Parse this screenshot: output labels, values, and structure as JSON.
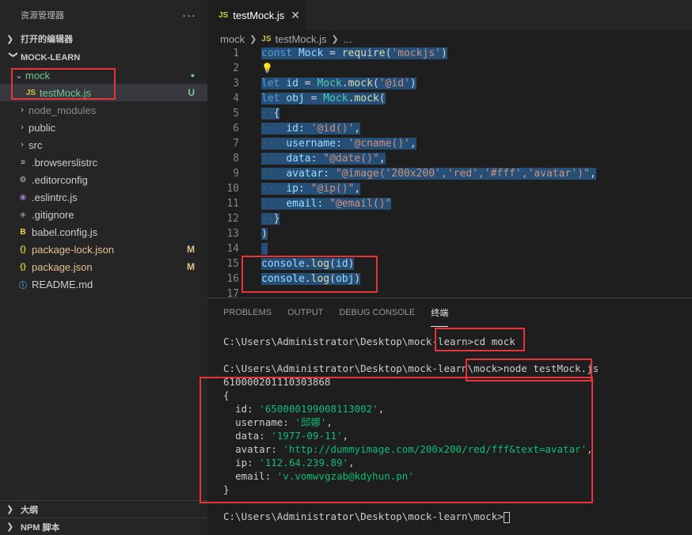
{
  "sidebar": {
    "title": "资源管理器",
    "more": "···",
    "open_editors": "打开的编辑器",
    "project": "MOCK-LEARN",
    "items": [
      {
        "name": "mock",
        "type": "folder-open",
        "badge": "●"
      },
      {
        "name": "testMock.js",
        "type": "js",
        "badge": "U"
      },
      {
        "name": "node_modules",
        "type": "folder"
      },
      {
        "name": "public",
        "type": "folder"
      },
      {
        "name": "src",
        "type": "folder"
      },
      {
        "name": ".browserslistrc",
        "type": "list"
      },
      {
        "name": ".editorconfig",
        "type": "gear"
      },
      {
        "name": ".eslintrc.js",
        "type": "eslint"
      },
      {
        "name": ".gitignore",
        "type": "git"
      },
      {
        "name": "babel.config.js",
        "type": "babel"
      },
      {
        "name": "package-lock.json",
        "type": "json",
        "badge": "M"
      },
      {
        "name": "package.json",
        "type": "json",
        "badge": "M"
      },
      {
        "name": "README.md",
        "type": "info"
      }
    ],
    "outline": "大纲",
    "npm": "NPM 脚本"
  },
  "editor": {
    "tab_label": "testMock.js",
    "tab_icon": "JS",
    "breadcrumb": [
      "mock",
      "testMock.js",
      "..."
    ]
  },
  "code_lines": [
    {
      "n": "1"
    },
    {
      "n": "2"
    },
    {
      "n": "3"
    },
    {
      "n": "4"
    },
    {
      "n": "5"
    },
    {
      "n": "6"
    },
    {
      "n": "7"
    },
    {
      "n": "8"
    },
    {
      "n": "9"
    },
    {
      "n": "10"
    },
    {
      "n": "11"
    },
    {
      "n": "12"
    },
    {
      "n": "13"
    },
    {
      "n": "14"
    },
    {
      "n": "15"
    },
    {
      "n": "16"
    },
    {
      "n": "17"
    }
  ],
  "code": {
    "l1": [
      "const",
      "Mock",
      "require",
      "'mockjs'"
    ],
    "l3": [
      "let",
      "id",
      "Mock",
      "mock",
      "'@id'"
    ],
    "l4": [
      "let",
      "obj",
      "Mock",
      "mock"
    ],
    "l6": [
      "id",
      "'@id()'"
    ],
    "l7": [
      "username",
      "'@cname()'"
    ],
    "l8": [
      "data",
      "\"@date()\""
    ],
    "l9": [
      "avatar",
      "\"@image('200x200','red','#fff','avatar')\""
    ],
    "l10": [
      "ip",
      "\"@ip()\""
    ],
    "l11": [
      "email",
      "\"@email()\""
    ],
    "l15": [
      "console",
      "log",
      "id"
    ],
    "l16": [
      "console",
      "log",
      "obj"
    ]
  },
  "panel": {
    "tabs": [
      "PROBLEMS",
      "OUTPUT",
      "DEBUG CONSOLE",
      "终端"
    ],
    "active_tab": "终端"
  },
  "terminal": {
    "prompt1": "C:\\Users\\Administrator\\Desktop\\mock-learn>",
    "cmd1": "cd mock",
    "prompt2": "C:\\Users\\Administrator\\Desktop\\mock-learn\\mock>",
    "cmd2": "node testMock.js",
    "out_id": "610000201110303868",
    "obj_open": "{",
    "fields": [
      {
        "key": "id",
        "value": "'650000199008113002'"
      },
      {
        "key": "username",
        "value": "'邱娜'"
      },
      {
        "key": "data",
        "value": "'1977-09-11'"
      },
      {
        "key": "avatar",
        "value": "'http://dummyimage.com/200x200/red/fff&text=avatar'"
      },
      {
        "key": "ip",
        "value": "'112.64.239.89'"
      },
      {
        "key": "email",
        "value": "'v.vomwvgzab@kdyhun.pn'"
      }
    ],
    "obj_close": "}",
    "prompt3": "C:\\Users\\Administrator\\Desktop\\mock-learn\\mock>"
  },
  "colors": {
    "highlight": "#e8323c",
    "selection": "#264f78",
    "accent_green": "#73c991",
    "modified": "#e2c08d"
  }
}
